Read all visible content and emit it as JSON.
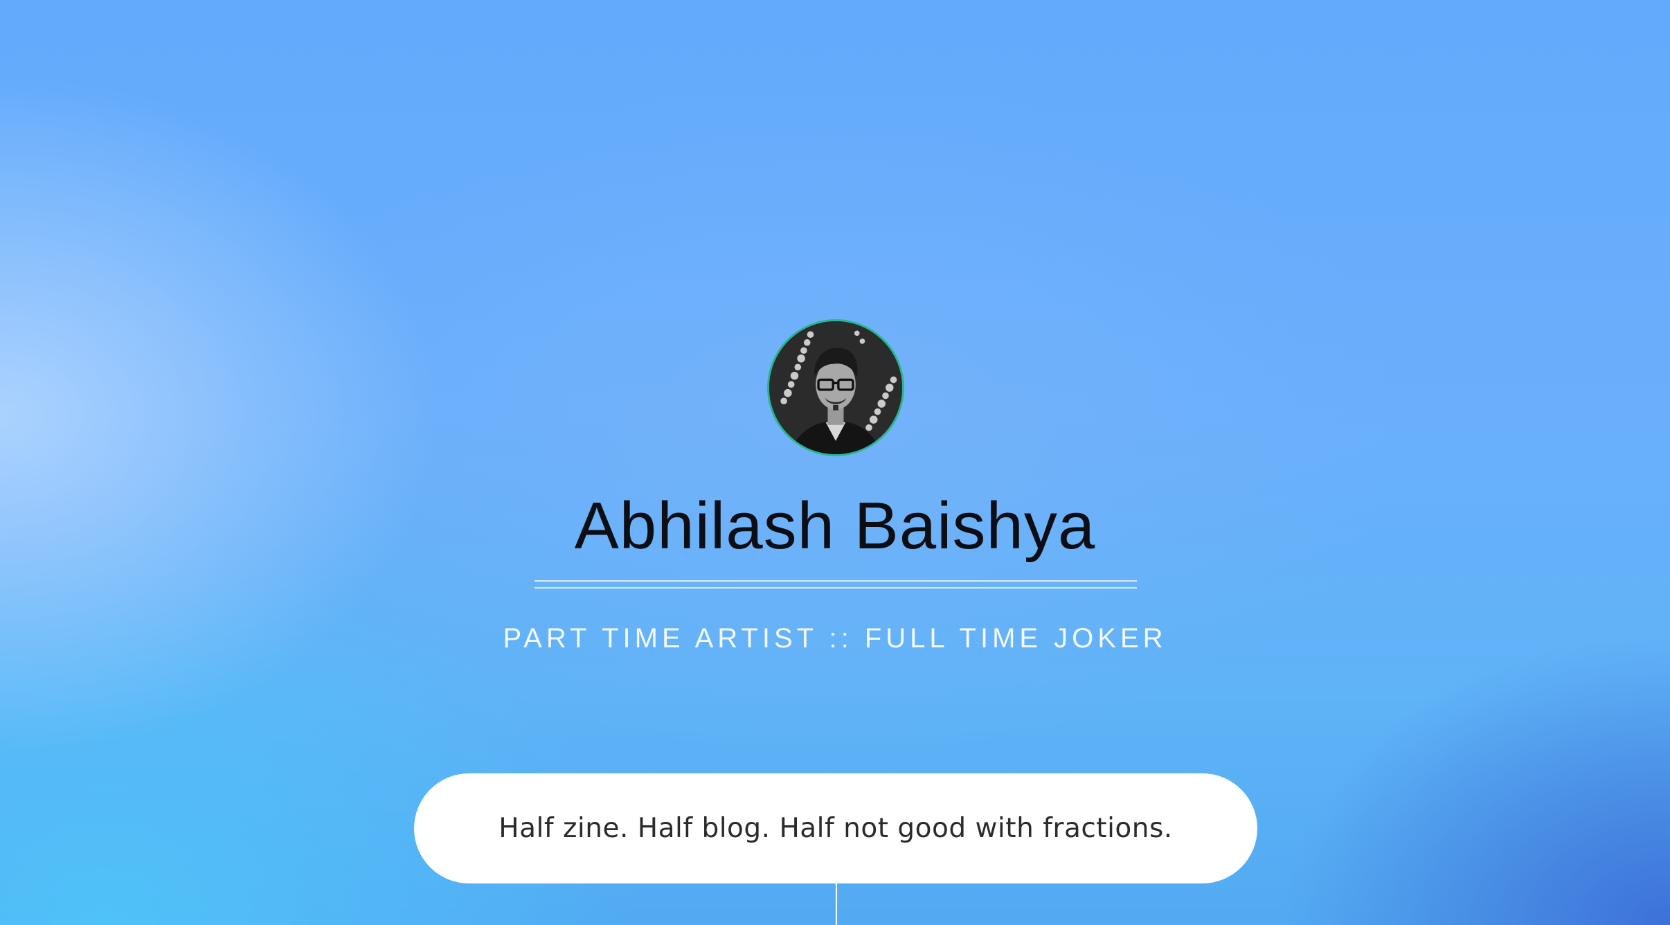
{
  "profile": {
    "name": "Abhilash Baishya",
    "tagline": "PART TIME ARTIST :: FULL TIME JOKER",
    "avatar_alt": "avatar"
  },
  "intro": {
    "text": "Half zine. Half blog. Half not good with fractions."
  },
  "colors": {
    "avatar_border": "#28b58f",
    "name_text": "#0d0d14",
    "tagline_text": "#f4f9ff",
    "pill_bg": "#ffffff",
    "pill_text": "#2b2b2b"
  }
}
